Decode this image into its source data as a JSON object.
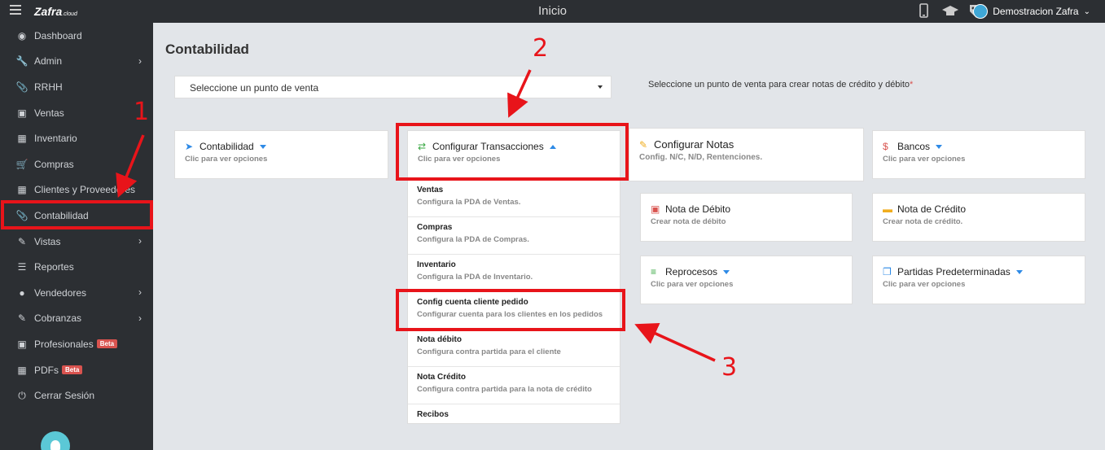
{
  "topbar": {
    "logo": "Zafra",
    "logo_suffix": ".cloud",
    "title": "Inicio",
    "user_name": "Demostracion Zafra"
  },
  "sidebar": {
    "items": [
      {
        "label": "Dashboard",
        "icon": "dashboard-icon",
        "chevron": false
      },
      {
        "label": "Admin",
        "icon": "wrench-icon",
        "chevron": true
      },
      {
        "label": "RRHH",
        "icon": "paperclip-icon",
        "chevron": false
      },
      {
        "label": "Ventas",
        "icon": "money-icon",
        "chevron": false
      },
      {
        "label": "Inventario",
        "icon": "book-icon",
        "chevron": false
      },
      {
        "label": "Compras",
        "icon": "cart-icon",
        "chevron": false
      },
      {
        "label": "Clientes y Proveedores",
        "icon": "book-icon",
        "chevron": false
      },
      {
        "label": "Contabilidad",
        "icon": "paperclip-icon",
        "chevron": false
      },
      {
        "label": "Vistas",
        "icon": "edit-icon",
        "chevron": true
      },
      {
        "label": "Reportes",
        "icon": "list-icon",
        "chevron": false
      },
      {
        "label": "Vendedores",
        "icon": "user-icon",
        "chevron": true
      },
      {
        "label": "Cobranzas",
        "icon": "edit-icon",
        "chevron": true
      },
      {
        "label": "Profesionales",
        "icon": "money-icon",
        "chevron": false,
        "badge": "Beta"
      },
      {
        "label": "PDFs",
        "icon": "book-icon",
        "chevron": false,
        "badge": "Beta"
      },
      {
        "label": "Cerrar Sesión",
        "icon": "power-icon",
        "chevron": false
      }
    ]
  },
  "main": {
    "title": "Contabilidad",
    "pos_select_value": "Seleccione un punto de venta",
    "pos_hint": "Seleccione un punto de venta para crear notas de crédito y débito",
    "pos_hint_required": "*"
  },
  "cards": {
    "contabilidad": {
      "title": "Contabilidad",
      "sub": "Clic para ver opciones"
    },
    "configurar_transacciones": {
      "title": "Configurar Transacciones",
      "sub": "Clic para ver opciones"
    },
    "configurar_notas": {
      "title": "Configurar Notas",
      "sub": "Config. N/C, N/D, Rentenciones."
    },
    "bancos": {
      "title": "Bancos",
      "sub": "Clic para ver opciones"
    },
    "nota_debito": {
      "title": "Nota de Débito",
      "sub": "Crear nota de débito"
    },
    "nota_credito": {
      "title": "Nota de Crédito",
      "sub": "Crear nota de crédito."
    },
    "reprocesos": {
      "title": "Reprocesos",
      "sub": "Clic para ver opciones"
    },
    "partidas": {
      "title": "Partidas Predeterminadas",
      "sub": "Clic para ver opciones"
    }
  },
  "dropdown": [
    {
      "title": "Ventas",
      "desc": "Configura la PDA de Ventas."
    },
    {
      "title": "Compras",
      "desc": "Configura la PDA de Compras."
    },
    {
      "title": "Inventario",
      "desc": "Configura la PDA de Inventario."
    },
    {
      "title": "Config cuenta cliente pedido",
      "desc": "Configurar cuenta para los clientes en los pedidos"
    },
    {
      "title": "Nota débito",
      "desc": "Configura contra partida para el cliente"
    },
    {
      "title": "Nota Crédito",
      "desc": "Configura contra partida para la nota de crédito"
    },
    {
      "title": "Recibos",
      "desc": ""
    }
  ],
  "annotations": {
    "n1": "1",
    "n2": "2",
    "n3": "3"
  },
  "colors": {
    "sidebar_bg": "#2c2f33",
    "accent": "#2e8ae6",
    "annotation": "#e8141a",
    "badge": "#d9534f"
  }
}
